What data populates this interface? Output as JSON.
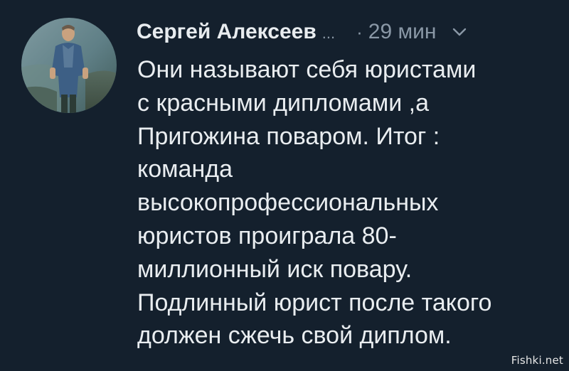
{
  "tweet": {
    "author": {
      "display_name": "Сергей  Алексеев",
      "name_truncation": "..."
    },
    "time_separator": "·",
    "timestamp": "29 мин",
    "menu_icon": "chevron-down-icon",
    "text_lines": [
      "Они называют себя юристами",
      "с красными дипломами ,а",
      "Пригожина поваром. Итог :",
      "команда",
      "высокопрофессиональных",
      "юристов проиграла 80-",
      "миллионный иск повару.",
      "Подлинный юрист после такого",
      "должен сжечь свой диплом."
    ]
  },
  "watermark": {
    "text": "Fishki.net"
  },
  "colors": {
    "background": "#14202d",
    "primary_text": "#e9edf0",
    "secondary_text": "#8a98a6"
  }
}
